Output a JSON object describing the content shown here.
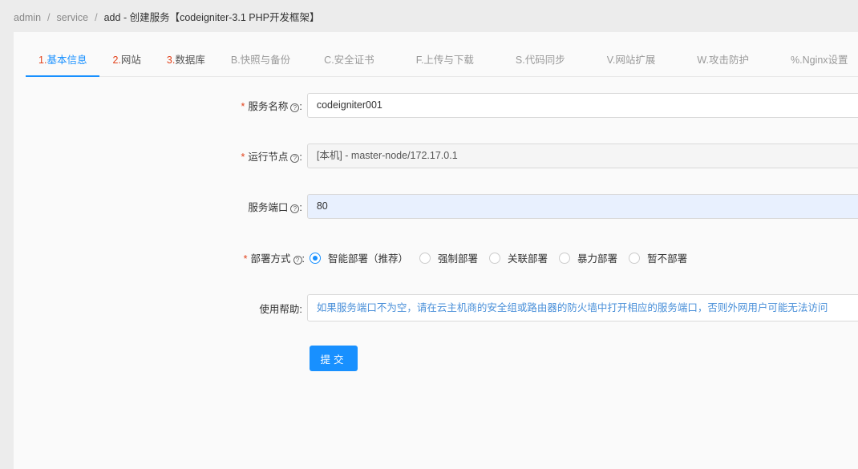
{
  "breadcrumb": {
    "items": [
      "admin",
      "service",
      "add"
    ],
    "title": "创建服务【codeigniter-3.1 PHP开发框架】"
  },
  "tabs": [
    {
      "num": "1.",
      "label": "基本信息"
    },
    {
      "num": "2.",
      "label": "网站"
    },
    {
      "num": "3.",
      "label": "数据库"
    },
    {
      "label": "B.快照与备份"
    },
    {
      "label": "C.安全证书"
    },
    {
      "label": "F.上传与下载"
    },
    {
      "label": "S.代码同步"
    },
    {
      "label": "V.网站扩展"
    },
    {
      "label": "W.攻击防护"
    },
    {
      "label": "%.Nginx设置"
    },
    {
      "label": "#."
    }
  ],
  "form": {
    "name": {
      "label": "服务名称",
      "value": "codeigniter001"
    },
    "node": {
      "label": "运行节点",
      "value": "[本机] - master-node/172.17.0.1"
    },
    "port": {
      "label": "服务端口",
      "value": "80"
    },
    "deploy": {
      "label": "部署方式",
      "options": [
        "智能部署（推荐）",
        "强制部署",
        "关联部署",
        "暴力部署",
        "暂不部署"
      ],
      "selected": 0
    },
    "help": {
      "label": "使用帮助",
      "value": "如果服务端口不为空，请在云主机商的安全组或路由器的防火墙中打开相应的服务端口，否则外网用户可能无法访问"
    },
    "submit": "提交",
    "required_mark": "*",
    "colon": ":",
    "q": "?"
  }
}
